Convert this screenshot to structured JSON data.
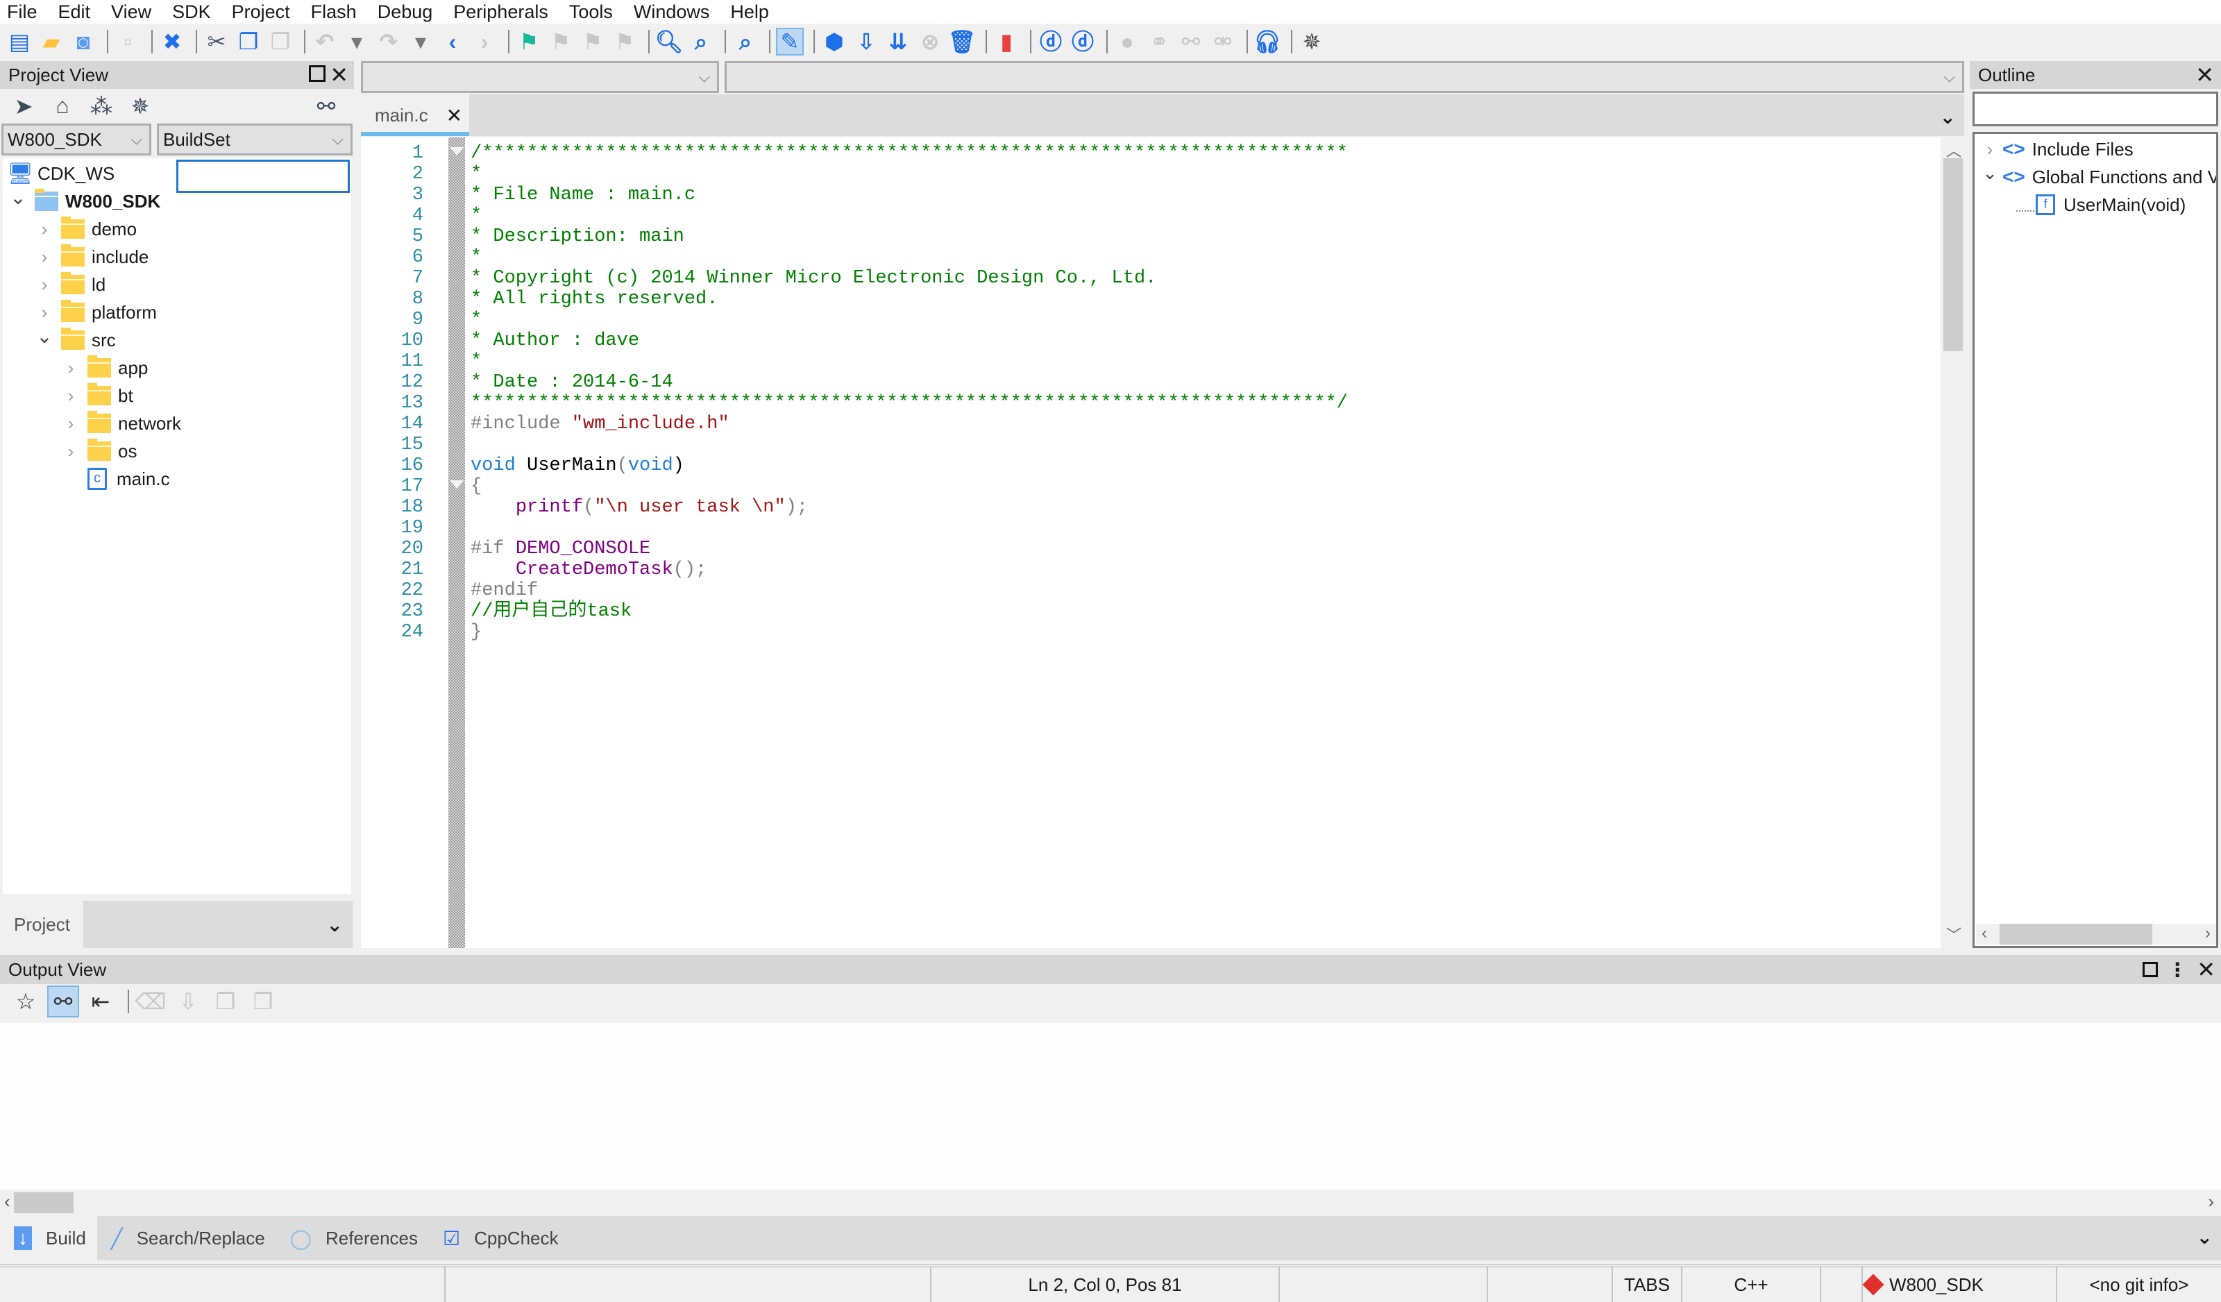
{
  "menu": [
    "File",
    "Edit",
    "View",
    "SDK",
    "Project",
    "Flash",
    "Debug",
    "Peripherals",
    "Tools",
    "Windows",
    "Help"
  ],
  "toolbar": {
    "icons": [
      "new-file-icon",
      "open-folder-icon",
      "reload-icon",
      "sep",
      "save-icon",
      "sep",
      "close-icon",
      "sep",
      "cut-icon",
      "copy-icon",
      "paste-icon",
      "sep",
      "undo-icon",
      "undo-dropdown-icon",
      "redo-icon",
      "redo-dropdown-icon",
      "back-icon",
      "forward-icon",
      "sep",
      "bookmark-toggle-icon",
      "bookmark-prev-icon",
      "bookmark-next-icon",
      "bookmark-clear-icon",
      "sep",
      "find-icon",
      "find-in-files-icon",
      "sep",
      "find-symbol-icon",
      "sep",
      "build-icon",
      "sep",
      "rebuild-icon",
      "download-icon",
      "download-all-icon",
      "stop-icon",
      "clean-icon",
      "sep",
      "load-icon",
      "sep",
      "debug-start-icon",
      "debug-attach-icon",
      "sep",
      "connect-icon",
      "connect-alt-icon",
      "link-icon",
      "disconnect-icon",
      "sep",
      "headset-icon",
      "sep",
      "bug-icon"
    ]
  },
  "project_view": {
    "title": "Project View",
    "icons": [
      "locate-icon",
      "home-icon",
      "dependency-icon",
      "bug-icon",
      "link-icon"
    ],
    "project_combo": "W800_SDK",
    "buildset_combo": "BuildSet",
    "filter_input": "",
    "tree": [
      {
        "label": "CDK_WS",
        "level": 0,
        "icon": "workspace-icon",
        "expand": ""
      },
      {
        "label": "W800_SDK",
        "level": 0,
        "icon": "project-folder-icon",
        "expand": "open",
        "bold": true
      },
      {
        "label": "demo",
        "level": 1,
        "icon": "folder-icon",
        "expand": "closed"
      },
      {
        "label": "include",
        "level": 1,
        "icon": "folder-icon",
        "expand": "closed"
      },
      {
        "label": "ld",
        "level": 1,
        "icon": "folder-icon",
        "expand": "closed"
      },
      {
        "label": "platform",
        "level": 1,
        "icon": "folder-icon",
        "expand": "closed"
      },
      {
        "label": "src",
        "level": 1,
        "icon": "folder-icon",
        "expand": "open"
      },
      {
        "label": "app",
        "level": 2,
        "icon": "folder-icon",
        "expand": "closed"
      },
      {
        "label": "bt",
        "level": 2,
        "icon": "folder-icon",
        "expand": "closed"
      },
      {
        "label": "network",
        "level": 2,
        "icon": "folder-icon",
        "expand": "closed"
      },
      {
        "label": "os",
        "level": 2,
        "icon": "folder-icon",
        "expand": "closed"
      },
      {
        "label": "main.c",
        "level": 2,
        "icon": "c-file-icon",
        "expand": ""
      }
    ],
    "bottom_tab": "Project"
  },
  "editor": {
    "tab": "main.c",
    "symbol_combo": "",
    "scope_combo": "",
    "lines": [
      [
        [
          "c-com",
          "/*****************************************************************************"
        ]
      ],
      [
        [
          "c-com",
          "*"
        ]
      ],
      [
        [
          "c-com",
          "* File Name : main.c"
        ]
      ],
      [
        [
          "c-com",
          "*"
        ]
      ],
      [
        [
          "c-com",
          "* Description: main"
        ]
      ],
      [
        [
          "c-com",
          "*"
        ]
      ],
      [
        [
          "c-com",
          "* Copyright (c) 2014 Winner Micro Electronic Design Co., Ltd."
        ]
      ],
      [
        [
          "c-com",
          "* All rights reserved."
        ]
      ],
      [
        [
          "c-com",
          "*"
        ]
      ],
      [
        [
          "c-com",
          "* Author : dave"
        ]
      ],
      [
        [
          "c-com",
          "*"
        ]
      ],
      [
        [
          "c-com",
          "* Date : 2014-6-14"
        ]
      ],
      [
        [
          "c-com",
          "*****************************************************************************/"
        ]
      ],
      [
        [
          "c-pp",
          "#include "
        ],
        [
          "c-str",
          "\"wm_include.h\""
        ]
      ],
      [
        [
          "c-id",
          ""
        ]
      ],
      [
        [
          "c-kw",
          "void"
        ],
        [
          "c-id",
          " UserMain"
        ],
        [
          "c-pp",
          "("
        ],
        [
          "c-kw",
          "void"
        ],
        [
          "c-id",
          ")"
        ]
      ],
      [
        [
          "c-pp",
          "{"
        ]
      ],
      [
        [
          "c-id",
          "    "
        ],
        [
          "c-fn",
          "printf"
        ],
        [
          "c-pp",
          "("
        ],
        [
          "c-str",
          "\"\\n user task \\n\""
        ],
        [
          "c-pp",
          ");"
        ]
      ],
      [
        [
          "c-id",
          ""
        ]
      ],
      [
        [
          "c-pp",
          "#if "
        ],
        [
          "c-fn",
          "DEMO_CONSOLE"
        ]
      ],
      [
        [
          "c-id",
          "    "
        ],
        [
          "c-fn",
          "CreateDemoTask"
        ],
        [
          "c-pp",
          "();"
        ]
      ],
      [
        [
          "c-pp",
          "#endif"
        ]
      ],
      [
        [
          "c-com",
          "//用户自己的task"
        ]
      ],
      [
        [
          "c-pp",
          "}"
        ]
      ]
    ],
    "fold_markers": [
      1,
      17
    ]
  },
  "outline": {
    "title": "Outline",
    "filter": "",
    "items": [
      {
        "label": "Include Files",
        "expand": "closed",
        "icon": "code-brackets-icon"
      },
      {
        "label": "Global Functions and Variables",
        "expand": "open",
        "icon": "code-brackets-icon"
      },
      {
        "label": "UserMain(void)",
        "expand": "",
        "icon": "function-icon",
        "child": true
      }
    ]
  },
  "output_view": {
    "title": "Output View",
    "icons": [
      "star-icon",
      "link-icon",
      "indent-icon",
      "sep",
      "clear-icon",
      "save-icon",
      "copy-icon",
      "paste-icon"
    ],
    "tabs": [
      {
        "label": "Build",
        "icon": "build-arrow-icon",
        "active": true
      },
      {
        "label": "Search/Replace",
        "icon": "pencil-icon",
        "active": false
      },
      {
        "label": "References",
        "icon": "circle-icon",
        "active": false
      },
      {
        "label": "CppCheck",
        "icon": "check-icon",
        "active": false
      }
    ]
  },
  "status": {
    "position": "Ln 2, Col 0, Pos 81",
    "indent": "TABS",
    "language": "C++",
    "project": "W800_SDK",
    "git": "<no git info>"
  },
  "colors": {
    "accent": "#1e6fe8",
    "folder": "#fdd14a",
    "tab_active": "#6bbbe9",
    "comment": "#008000"
  }
}
